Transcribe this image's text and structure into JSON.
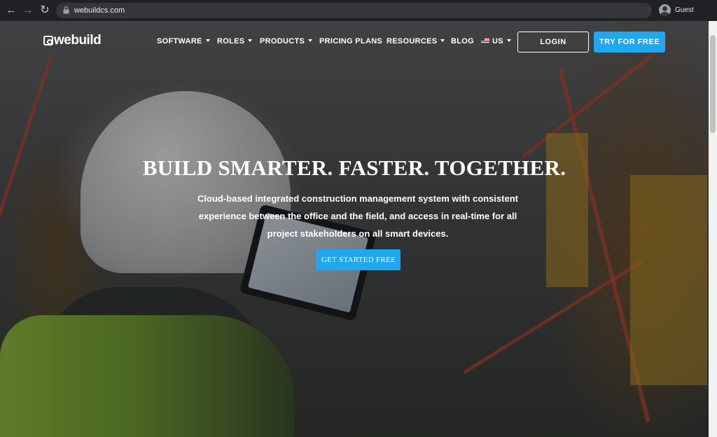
{
  "browser": {
    "url": "webuildcs.com",
    "profile_name": "Guest",
    "back_icon": "←",
    "forward_icon": "→",
    "reload_icon": "↻"
  },
  "header": {
    "logo_text": "webuild",
    "nav": {
      "software": "SOFTWARE",
      "roles": "ROLES",
      "products": "PRODUCTS",
      "pricing": "PRICING PLANS",
      "resources": "RESOURCES",
      "blog": "BLOG",
      "locale": "US"
    },
    "login_label": "LOGIN",
    "try_label": "TRY FOR FREE"
  },
  "hero": {
    "title": "BUILD SMARTER. FASTER. TOGETHER.",
    "subtitle": "Cloud-based integrated construction management system with consistent experience between the office and the field, and access in real-time for all project stakeholders on all smart devices.",
    "cta_label": "GET STARTED FREE"
  },
  "colors": {
    "accent": "#1fa7ef",
    "chrome_bg": "#202124"
  }
}
